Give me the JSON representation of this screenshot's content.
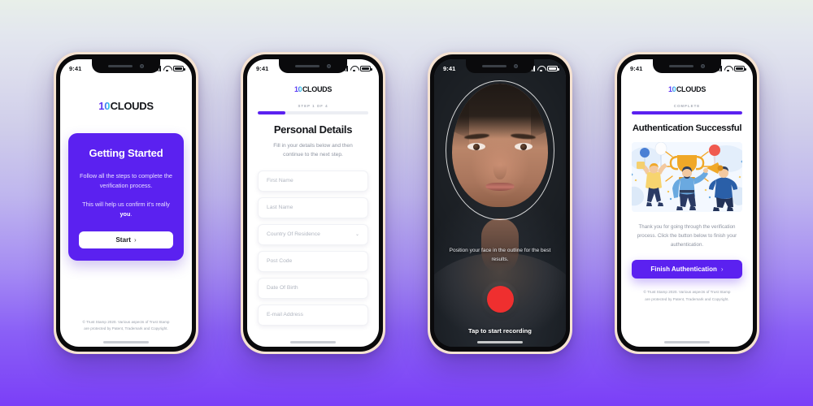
{
  "brand": {
    "mark": "10",
    "name": "CLOUDS"
  },
  "status_bar": {
    "time": "9:41",
    "signal_icon": "signal-bars-icon",
    "wifi_icon": "wifi-icon",
    "battery_icon": "battery-icon"
  },
  "legal": {
    "line1": "© Trust Stamp 2020. Various aspects of Trust Stamp",
    "line2": "are protected by Patent, Trademark and Copyright."
  },
  "screen1": {
    "card_title": "Getting Started",
    "para1": "Follow all the steps to complete the verification process.",
    "para2_prefix": "This will help us confirm it's really ",
    "para2_bold": "you",
    "para2_suffix": ".",
    "start_label": "Start",
    "chevron": "›"
  },
  "screen2": {
    "step_label": "STEP 1 OF 4",
    "progress_percent": 25,
    "title": "Personal Details",
    "subtitle": "Fill in your details below and then continue to the next step.",
    "fields": [
      {
        "placeholder": "First Name",
        "type": "text"
      },
      {
        "placeholder": "Last Name",
        "type": "text"
      },
      {
        "placeholder": "Country Of Residence",
        "type": "select",
        "caret": "⌄"
      },
      {
        "placeholder": "Post Code",
        "type": "text"
      },
      {
        "placeholder": "Date Of Birth",
        "type": "text"
      },
      {
        "placeholder": "E-mail Address",
        "type": "text"
      }
    ]
  },
  "screen3": {
    "hint": "Position your face in the outline for the best results.",
    "cta": "Tap to start recording",
    "record_button_color": "#ef2f2f"
  },
  "screen4": {
    "step_label": "COMPLETE",
    "progress_percent": 100,
    "title": "Authentication Successful",
    "body": "Thank you for going through the verification process. Click the button below to finish your authentication.",
    "finish_label": "Finish Authentication",
    "chevron": "›",
    "illustration": "celebration-trophy-illustration"
  },
  "theme": {
    "accent": "#5b21f0",
    "bg_top": "#e8efe9",
    "bg_bottom": "#7b3ff7",
    "phone_frame": "#f6e3d2",
    "bezel": "#0a0a0c"
  }
}
